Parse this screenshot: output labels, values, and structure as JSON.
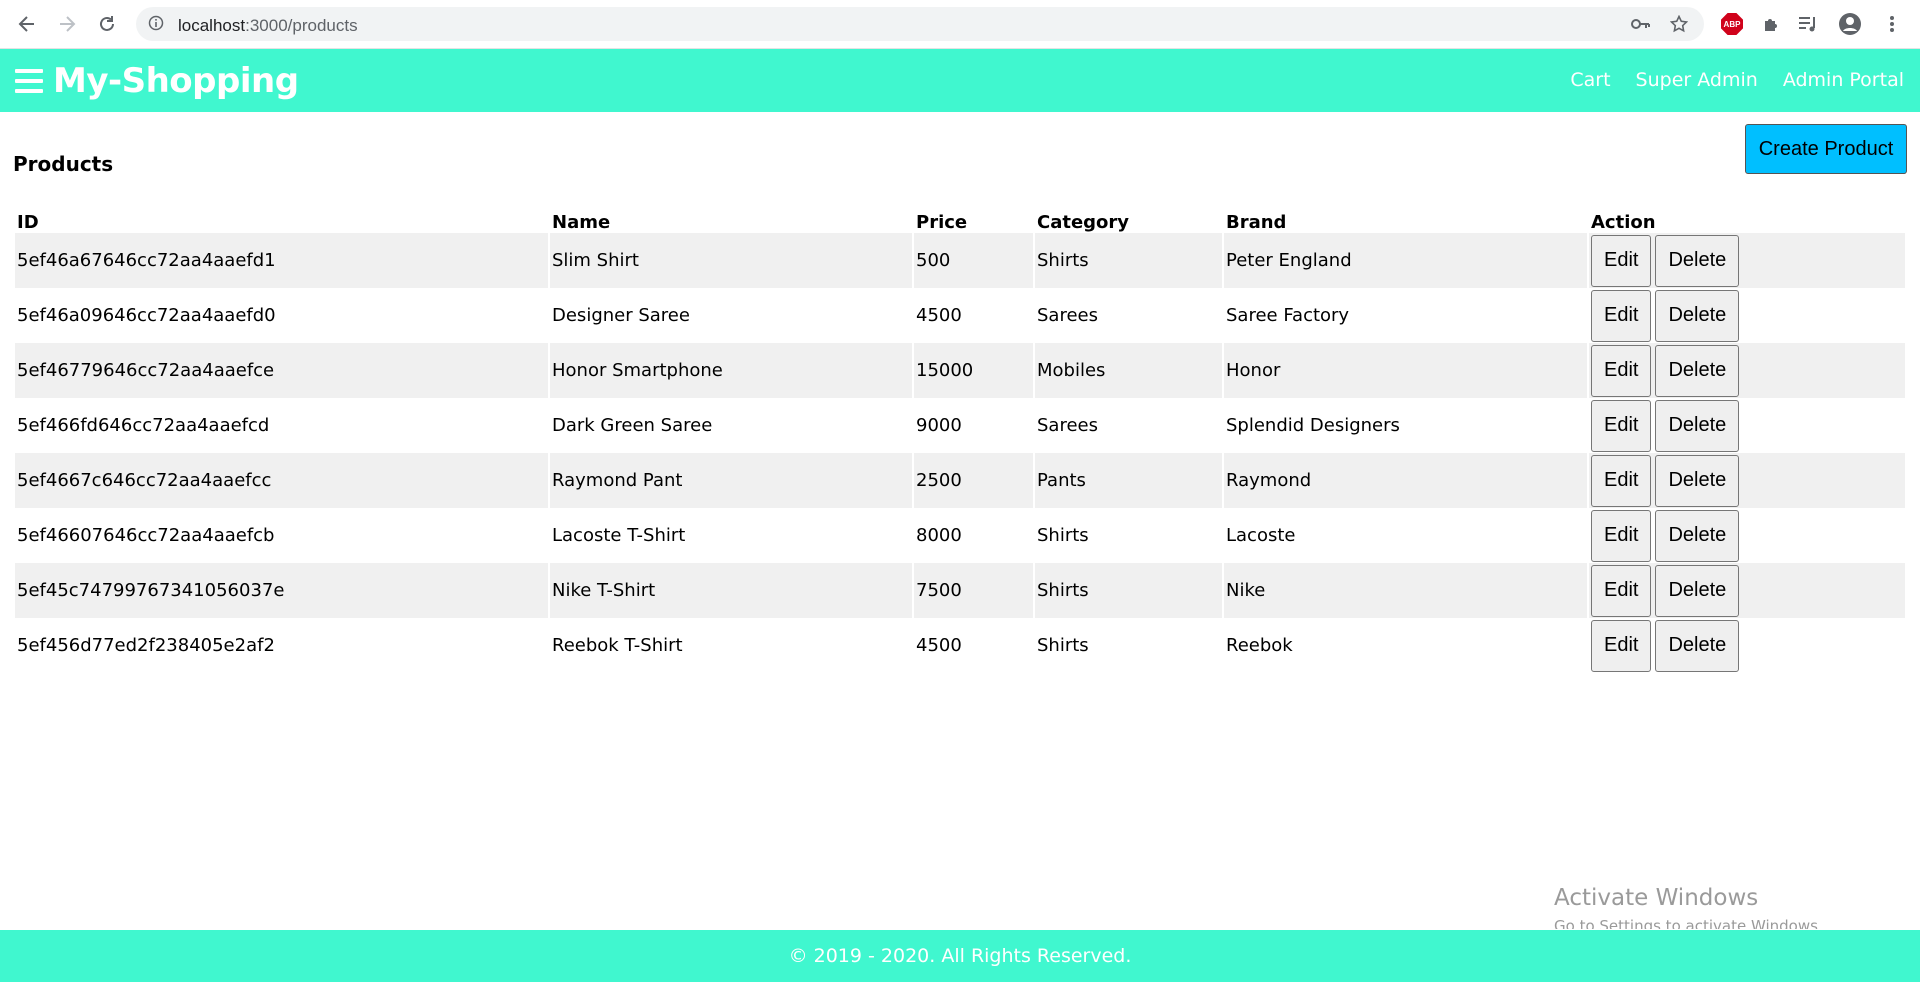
{
  "browser": {
    "url_host": "localhost",
    "url_path": ":3000/products"
  },
  "header": {
    "brand": "My-Shopping",
    "links": [
      "Cart",
      "Super Admin",
      "Admin Portal"
    ],
    "color": "#40f7cf"
  },
  "main": {
    "title": "Products",
    "create_label": "Create Product",
    "columns": [
      "ID",
      "Name",
      "Price",
      "Category",
      "Brand",
      "Action"
    ],
    "edit_label": "Edit",
    "delete_label": "Delete",
    "rows": [
      {
        "id": "5ef46a67646cc72aa4aaefd1",
        "name": "Slim Shirt",
        "price": "500",
        "category": "Shirts",
        "brand": "Peter England"
      },
      {
        "id": "5ef46a09646cc72aa4aaefd0",
        "name": "Designer Saree",
        "price": "4500",
        "category": "Sarees",
        "brand": "Saree Factory"
      },
      {
        "id": "5ef46779646cc72aa4aaefce",
        "name": "Honor Smartphone",
        "price": "15000",
        "category": "Mobiles",
        "brand": "Honor"
      },
      {
        "id": "5ef466fd646cc72aa4aaefcd",
        "name": "Dark Green Saree",
        "price": "9000",
        "category": "Sarees",
        "brand": "Splendid Designers"
      },
      {
        "id": "5ef4667c646cc72aa4aaefcc",
        "name": "Raymond Pant",
        "price": "2500",
        "category": "Pants",
        "brand": "Raymond"
      },
      {
        "id": "5ef46607646cc72aa4aaefcb",
        "name": "Lacoste T-Shirt",
        "price": "8000",
        "category": "Shirts",
        "brand": "Lacoste"
      },
      {
        "id": "5ef45c74799767341056037e",
        "name": "Nike T-Shirt",
        "price": "7500",
        "category": "Shirts",
        "brand": "Nike"
      },
      {
        "id": "5ef456d77ed2f238405e2af2",
        "name": "Reebok T-Shirt",
        "price": "4500",
        "category": "Shirts",
        "brand": "Reebok"
      }
    ]
  },
  "watermark": {
    "line1": "Activate Windows",
    "line2": "Go to Settings to activate Windows."
  },
  "footer": {
    "text": "© 2019 - 2020. All Rights Reserved."
  }
}
